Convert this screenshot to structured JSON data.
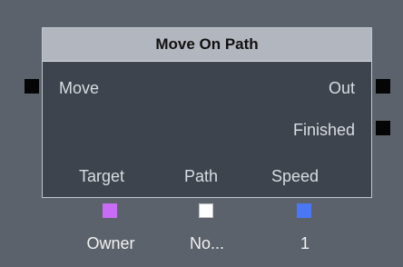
{
  "node": {
    "title": "Move On Path",
    "inputs": [
      {
        "label": "Move"
      }
    ],
    "outputs": [
      {
        "label": "Out"
      },
      {
        "label": "Finished"
      }
    ],
    "variables": [
      {
        "label": "Target",
        "value": "Owner",
        "color": "#c86cf5"
      },
      {
        "label": "Path",
        "value": "No...",
        "color": "#ffffff"
      },
      {
        "label": "Speed",
        "value": "1",
        "color": "#4a77f5"
      }
    ]
  },
  "colors": {
    "canvas": "#5c626b",
    "node_body": "#3e444e",
    "node_header": "#b2b7bf",
    "pin": "#050505"
  }
}
